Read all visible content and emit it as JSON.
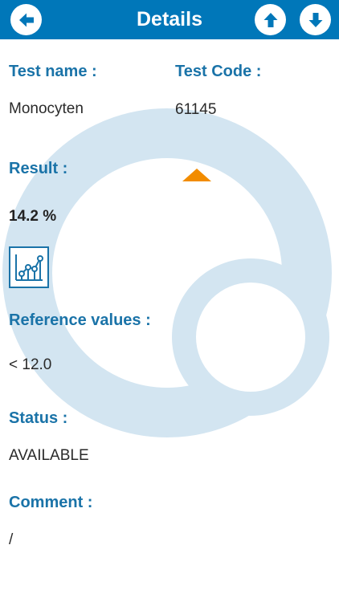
{
  "header": {
    "title": "Details",
    "back_icon": "arrow-left-icon",
    "up_icon": "arrow-up-icon",
    "down_icon": "arrow-down-icon",
    "color": "#0077b9"
  },
  "test_name": {
    "label": "Test name :",
    "value": "Monocyten"
  },
  "test_code": {
    "label": "Test Code :",
    "value": "61145"
  },
  "result": {
    "label": "Result :",
    "value": "14.2 %",
    "trend_icon": "triangle-up-icon",
    "trend_color": "#f28c00",
    "chart_icon": "line-chart-icon"
  },
  "reference": {
    "label": "Reference values :",
    "value": "< 12.0"
  },
  "status": {
    "label": "Status :",
    "value": "AVAILABLE"
  },
  "comment": {
    "label": "Comment :",
    "value": "/"
  },
  "colors": {
    "label": "#1a73a8",
    "watermark": "#cfe2ef"
  }
}
